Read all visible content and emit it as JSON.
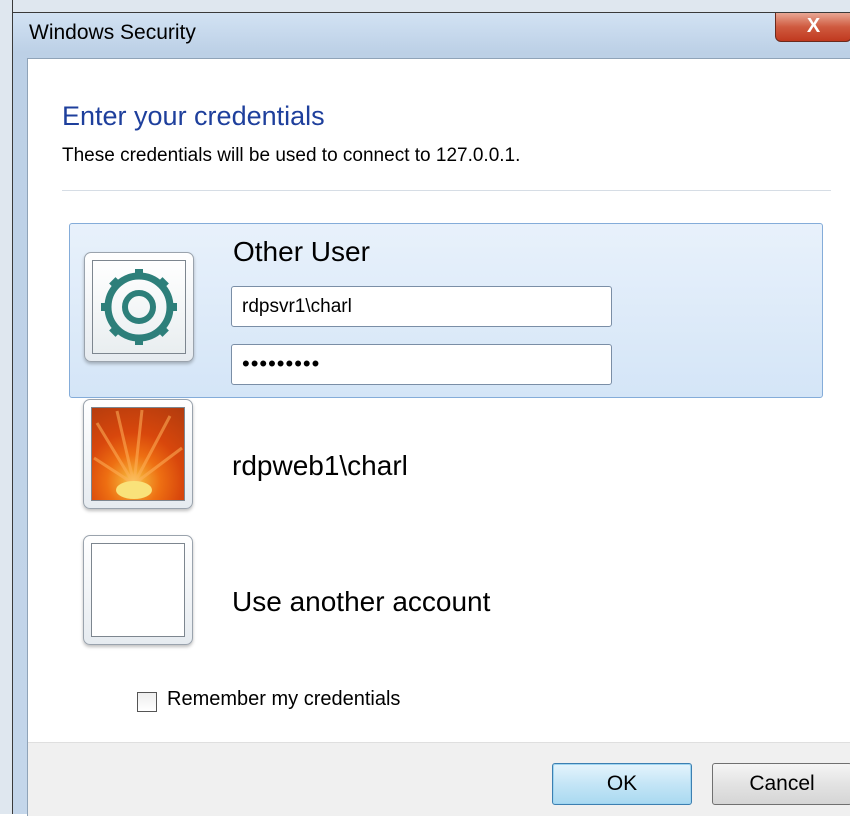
{
  "dialog": {
    "title": "Windows Security",
    "close_glyph": "X",
    "heading": "Enter your credentials",
    "subtext": "These credentials will be used to connect to 127.0.0.1."
  },
  "selected_user": {
    "name": "Other User",
    "icon": "gear-icon",
    "username_value": "rdpsvr1\\charl",
    "password_masked": "•••••••••"
  },
  "other_users": [
    {
      "name": "rdpweb1\\charl",
      "icon": "flower-avatar-icon"
    },
    {
      "name": "Use another account",
      "icon": "blank-avatar-icon"
    }
  ],
  "remember": {
    "label": "Remember my credentials",
    "checked": false
  },
  "buttons": {
    "ok": "OK",
    "cancel": "Cancel"
  },
  "colors": {
    "heading": "#1e3f9c",
    "selection": "#d4e5f7",
    "accent": "#3c7fb1"
  }
}
